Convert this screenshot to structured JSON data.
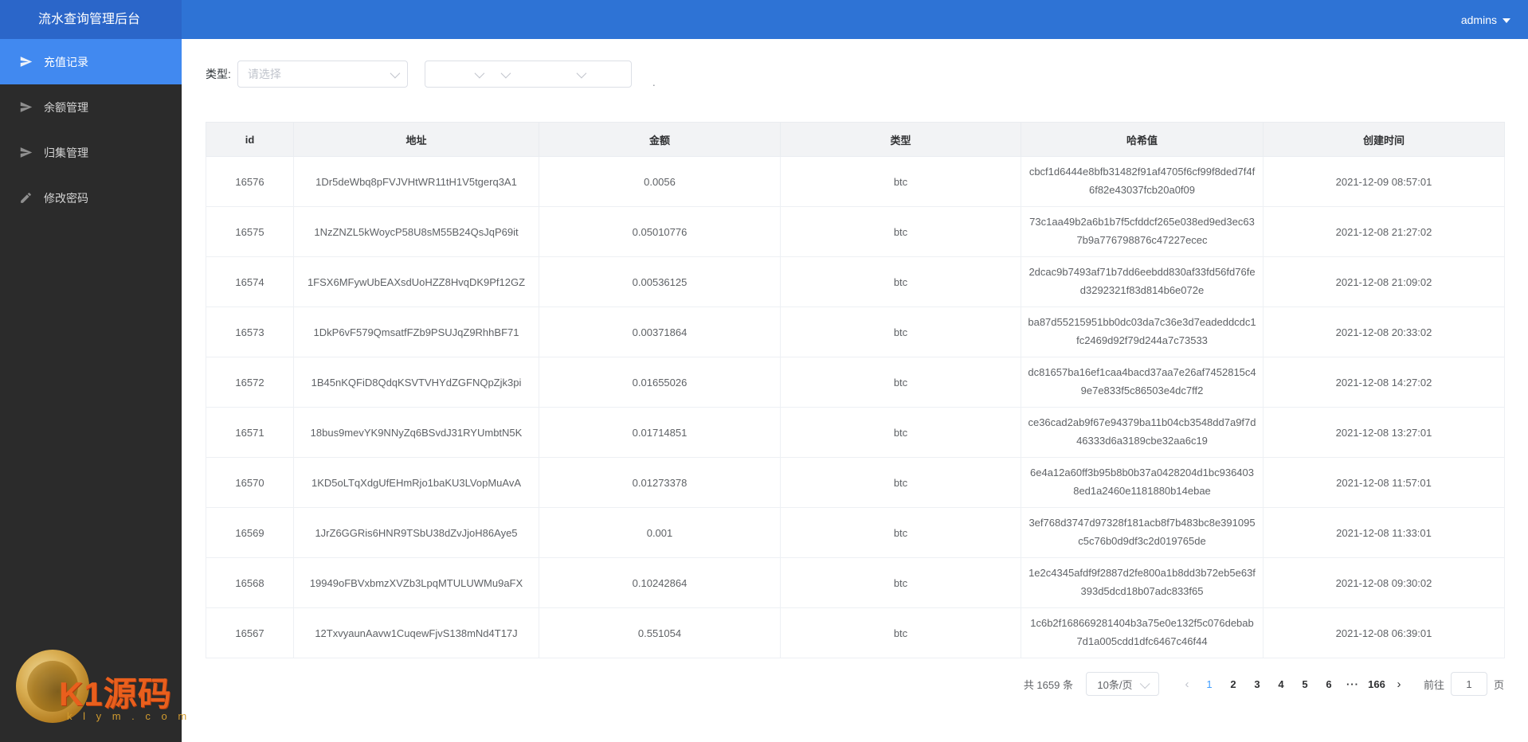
{
  "app": {
    "title": "流水查询管理后台",
    "user_menu": "admins"
  },
  "sidebar": {
    "items": [
      {
        "label": "充值记录",
        "icon": "send-icon",
        "active": true
      },
      {
        "label": "余额管理",
        "icon": "send-icon",
        "active": false
      },
      {
        "label": "归集管理",
        "icon": "send-icon",
        "active": false
      },
      {
        "label": "修改密码",
        "icon": "pencil-icon",
        "active": false
      }
    ]
  },
  "filter": {
    "type_label": "类型:",
    "type_placeholder": "请选择",
    "dot": "."
  },
  "table": {
    "columns": [
      "id",
      "地址",
      "金额",
      "类型",
      "哈希值",
      "创建时间"
    ],
    "rows": [
      {
        "id": "16576",
        "address": "1Dr5deWbq8pFVJVHtWR11tH1V5tgerq3A1",
        "amount": "0.0056",
        "type": "btc",
        "hash": "cbcf1d6444e8bfb31482f91af4705f6cf99f8ded7f4f6f82e43037fcb20a0f09",
        "created": "2021-12-09 08:57:01"
      },
      {
        "id": "16575",
        "address": "1NzZNZL5kWoycP58U8sM55B24QsJqP69it",
        "amount": "0.05010776",
        "type": "btc",
        "hash": "73c1aa49b2a6b1b7f5cfddcf265e038ed9ed3ec637b9a776798876c47227ecec",
        "created": "2021-12-08 21:27:02"
      },
      {
        "id": "16574",
        "address": "1FSX6MFywUbEAXsdUoHZZ8HvqDK9Pf12GZ",
        "amount": "0.00536125",
        "type": "btc",
        "hash": "2dcac9b7493af71b7dd6eebdd830af33fd56fd76fed3292321f83d814b6e072e",
        "created": "2021-12-08 21:09:02"
      },
      {
        "id": "16573",
        "address": "1DkP6vF579QmsatfFZb9PSUJqZ9RhhBF71",
        "amount": "0.00371864",
        "type": "btc",
        "hash": "ba87d55215951bb0dc03da7c36e3d7eadeddcdc1fc2469d92f79d244a7c73533",
        "created": "2021-12-08 20:33:02"
      },
      {
        "id": "16572",
        "address": "1B45nKQFiD8QdqKSVTVHYdZGFNQpZjk3pi",
        "amount": "0.01655026",
        "type": "btc",
        "hash": "dc81657ba16ef1caa4bacd37aa7e26af7452815c49e7e833f5c86503e4dc7ff2",
        "created": "2021-12-08 14:27:02"
      },
      {
        "id": "16571",
        "address": "18bus9mevYK9NNyZq6BSvdJ31RYUmbtN5K",
        "amount": "0.01714851",
        "type": "btc",
        "hash": "ce36cad2ab9f67e94379ba11b04cb3548dd7a9f7d46333d6a3189cbe32aa6c19",
        "created": "2021-12-08 13:27:01"
      },
      {
        "id": "16570",
        "address": "1KD5oLTqXdgUfEHmRjo1baKU3LVopMuAvA",
        "amount": "0.01273378",
        "type": "btc",
        "hash": "6e4a12a60ff3b95b8b0b37a0428204d1bc9364038ed1a2460e1181880b14ebae",
        "created": "2021-12-08 11:57:01"
      },
      {
        "id": "16569",
        "address": "1JrZ6GGRis6HNR9TSbU38dZvJjoH86Aye5",
        "amount": "0.001",
        "type": "btc",
        "hash": "3ef768d3747d97328f181acb8f7b483bc8e391095c5c76b0d9df3c2d019765de",
        "created": "2021-12-08 11:33:01"
      },
      {
        "id": "16568",
        "address": "19949oFBVxbmzXVZb3LpqMTULUWMu9aFX",
        "amount": "0.10242864",
        "type": "btc",
        "hash": "1e2c4345afdf9f2887d2fe800a1b8dd3b72eb5e63f393d5dcd18b07adc833f65",
        "created": "2021-12-08 09:30:02"
      },
      {
        "id": "16567",
        "address": "12TxvyaunAavw1CuqewFjvS138mNd4T17J",
        "amount": "0.551054",
        "type": "btc",
        "hash": "1c6b2f168669281404b3a75e0e132f5c076debab7d1a005cdd1dfc6467c46f44",
        "created": "2021-12-08 06:39:01"
      }
    ]
  },
  "pagination": {
    "total_text": "共 1659 条",
    "page_size": "10条/页",
    "prev": "‹",
    "next": "›",
    "pages": [
      "1",
      "2",
      "3",
      "4",
      "5",
      "6"
    ],
    "active_page": "1",
    "ellipsis": "···",
    "last_page": "166",
    "goto_label": "前往",
    "goto_value": "1",
    "goto_suffix": "页"
  },
  "watermark": {
    "title": "K1源码",
    "subtitle": "k l y m . c o m"
  },
  "colors": {
    "topbar": "#2e73d5",
    "sidebar_active": "#4189f0",
    "page_active": "#409eff"
  }
}
